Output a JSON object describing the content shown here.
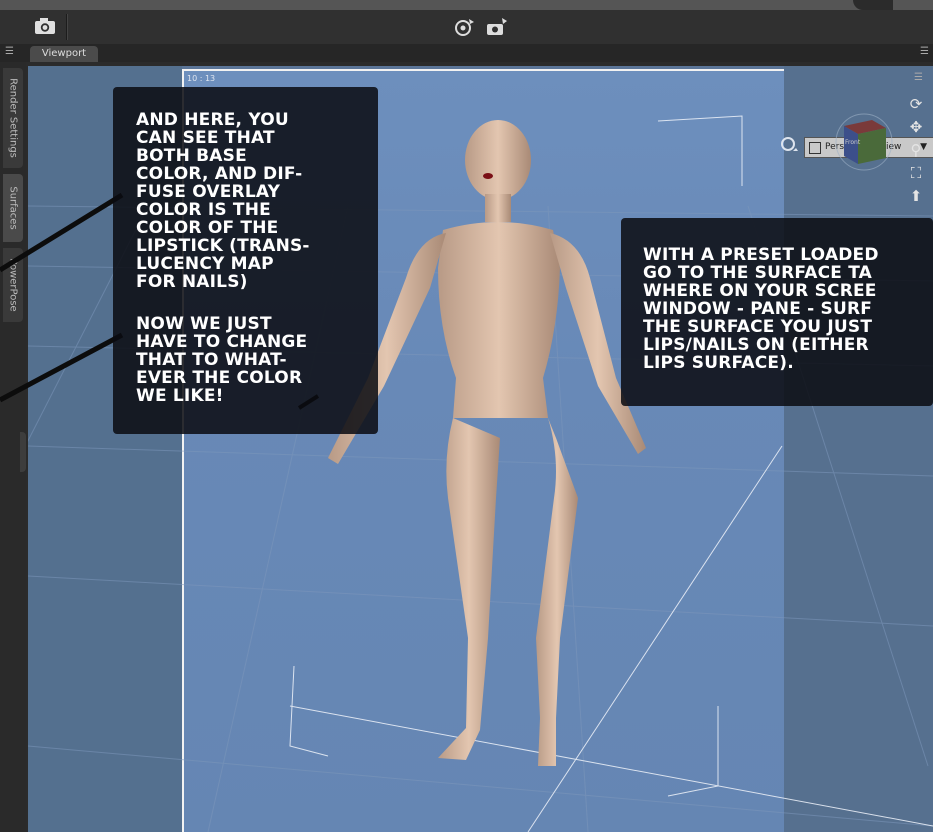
{
  "toolbar": {
    "camera_icon": "camera-icon",
    "tool_icons": [
      "rotate-camera-icon",
      "camera-settings-icon"
    ]
  },
  "tabs": {
    "viewport_label": "Viewport"
  },
  "left_rail": {
    "tabs": [
      "Render Settings",
      "Surfaces",
      "PowerPose"
    ]
  },
  "viewport": {
    "timestamp": "10 : 13",
    "view_select": "Perspective View",
    "nav_icons": [
      "orbit-icon",
      "pan-icon",
      "zoom-icon",
      "frame-icon",
      "reset-icon"
    ],
    "cube_label": "Front"
  },
  "callouts": {
    "first": {
      "text_a": "AND HERE, YOU\nCAN SEE THAT\nBOTH BASE\nCOLOR, AND DIF-\nFUSE OVERLAY\nCOLOR IS THE\nCOLOR OF THE\nLIPSTICK (TRANS-\nLUCENCY MAP\nFOR NAILS)",
      "text_b": "NOW WE JUST\nHAVE TO CHANGE\nTHAT TO WHAT-\nEVER THE COLOR\nWE LIKE!"
    },
    "second": {
      "text": "WITH A PRESET LOADED\nGO TO THE SURFACE TA\nWHERE ON YOUR SCREE\nWINDOW - PANE - SURF\nTHE SURFACE YOU JUST\nLIPS/NAILS ON (EITHER\nLIPS SURFACE)."
    }
  }
}
